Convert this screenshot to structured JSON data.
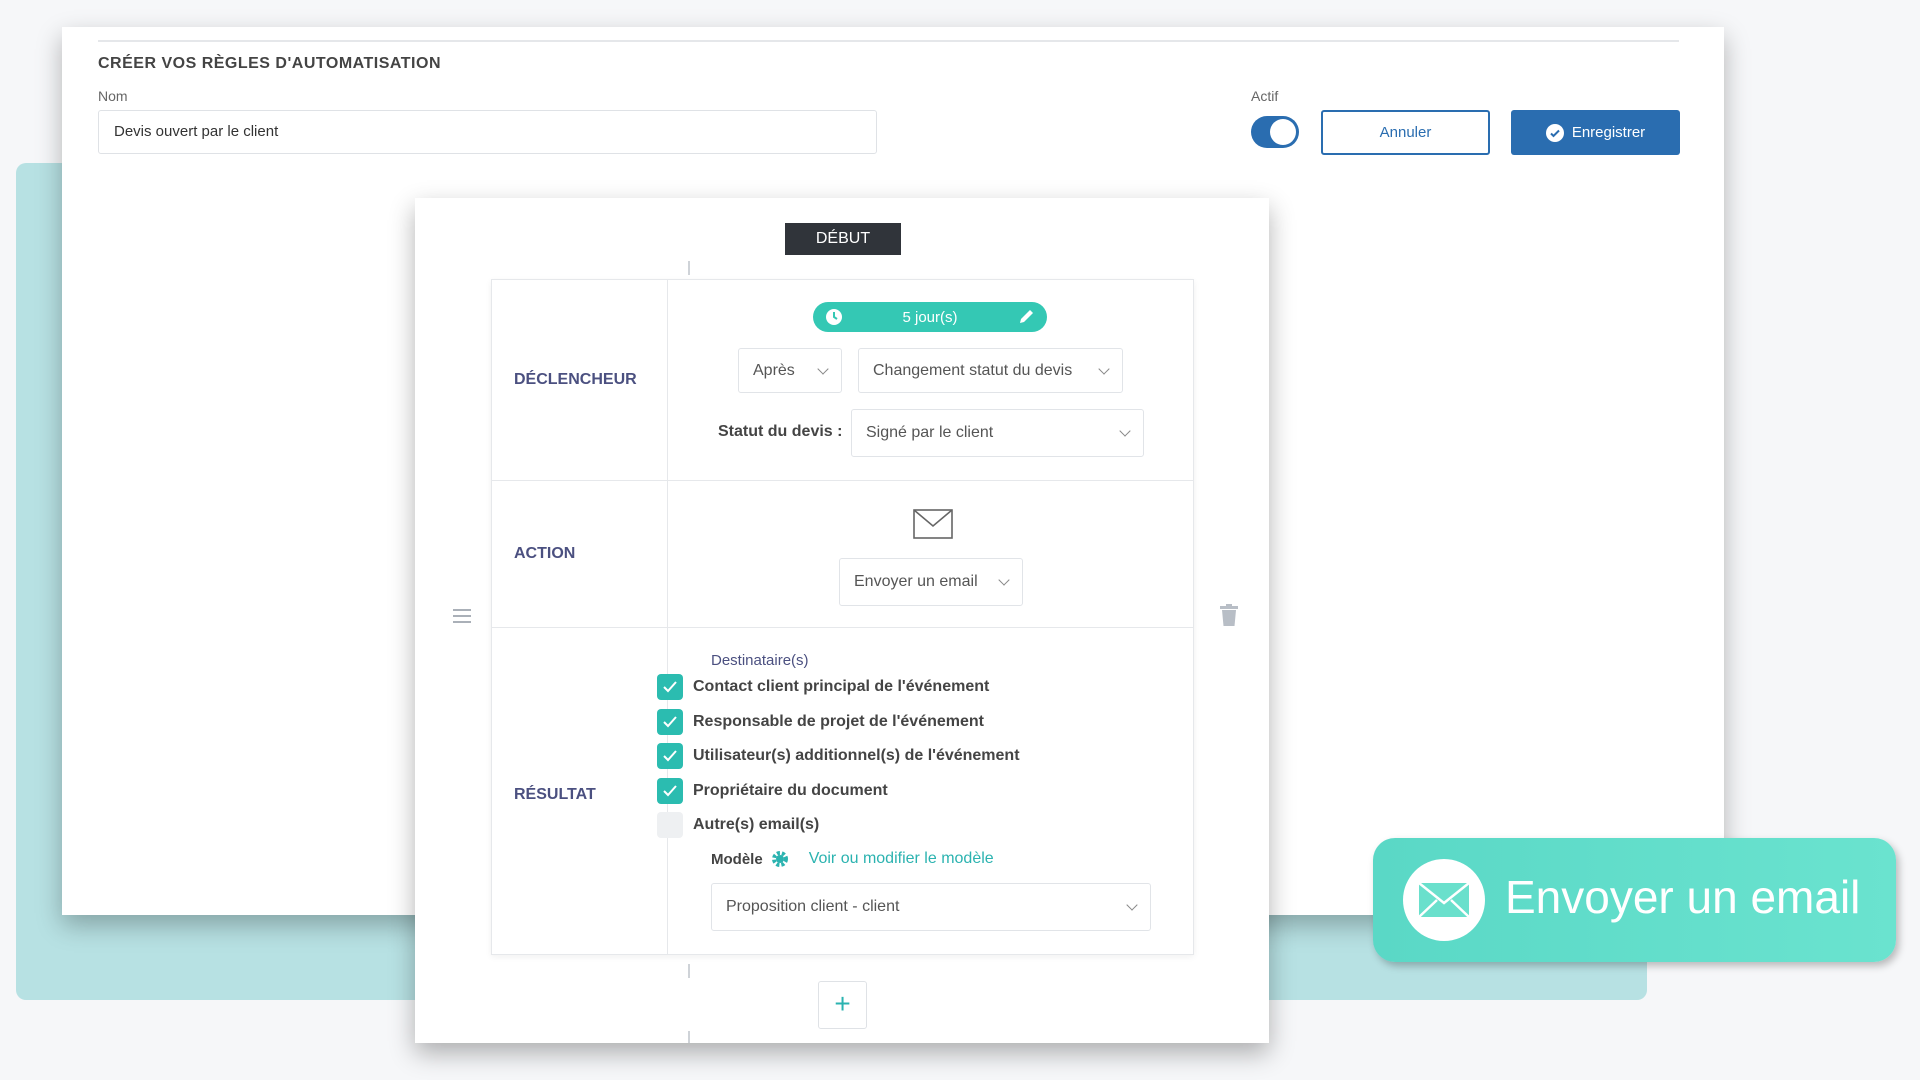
{
  "header": {
    "title": "CRÉER VOS RÈGLES D'AUTOMATISATION",
    "name_label": "Nom",
    "name_value": "Devis ouvert par le client",
    "active_label": "Actif",
    "active": true,
    "cancel_label": "Annuler",
    "save_label": "Enregistrer"
  },
  "flow": {
    "start_label": "DÉBUT",
    "trigger": {
      "label": "DÉCLENCHEUR",
      "delay": "5 jour(s)",
      "timing": "Après",
      "event": "Changement statut du devis",
      "status_label": "Statut du devis :",
      "status_value": "Signé par le client"
    },
    "action": {
      "label": "ACTION",
      "icon": "envelope-icon",
      "value": "Envoyer un email"
    },
    "result": {
      "label": "RÉSULTAT",
      "recipients_label": "Destinataire(s)",
      "recipients": [
        {
          "label": "Contact client principal de l'événement",
          "checked": true
        },
        {
          "label": "Responsable de projet de l'événement",
          "checked": true
        },
        {
          "label": "Utilisateur(s) additionnel(s) de l'événement",
          "checked": true
        },
        {
          "label": "Propriétaire du document",
          "checked": true
        },
        {
          "label": "Autre(s) email(s)",
          "checked": false
        }
      ],
      "template_label": "Modèle",
      "template_link": "Voir ou modifier le modèle",
      "template_value": "Proposition client - client"
    }
  },
  "badge": {
    "text": "Envoyer un email"
  },
  "colors": {
    "primary": "#2a6db0",
    "teal": "#34c8b4",
    "label": "#4b5080"
  }
}
